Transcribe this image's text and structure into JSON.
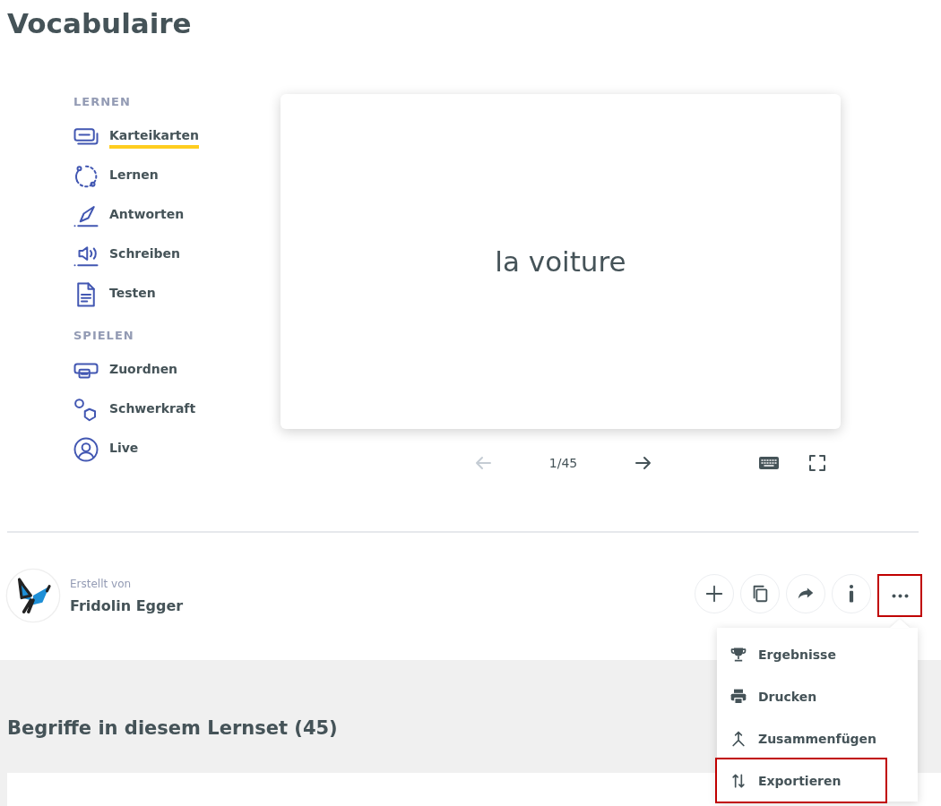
{
  "page": {
    "title": "Vocabulaire"
  },
  "sidebar": {
    "sections": [
      {
        "heading": "LERNEN",
        "items": [
          {
            "label": "Karteikarten",
            "kind": "cards",
            "selected": true
          },
          {
            "label": "Lernen",
            "kind": "cycle",
            "selected": false
          },
          {
            "label": "Antworten",
            "kind": "pen",
            "selected": false
          },
          {
            "label": "Schreiben",
            "kind": "speaker",
            "selected": false
          },
          {
            "label": "Testen",
            "kind": "document",
            "selected": false
          }
        ]
      },
      {
        "heading": "SPIELEN",
        "items": [
          {
            "label": "Zuordnen",
            "kind": "match",
            "selected": false
          },
          {
            "label": "Schwerkraft",
            "kind": "gravity",
            "selected": false
          },
          {
            "label": "Live",
            "kind": "person",
            "selected": false
          }
        ]
      }
    ]
  },
  "flashcard": {
    "term": "la voiture",
    "counter": "1/45",
    "controls": [
      {
        "kind": "previous",
        "disabled": true
      },
      {
        "kind": "next",
        "disabled": false
      },
      {
        "kind": "keyboard",
        "disabled": false
      },
      {
        "kind": "fullscreen",
        "disabled": false
      }
    ]
  },
  "author": {
    "label": "Erstellt von",
    "name": "Fridolin Egger"
  },
  "actions": [
    {
      "kind": "add",
      "highlighted": false
    },
    {
      "kind": "copy",
      "highlighted": false
    },
    {
      "kind": "share",
      "highlighted": false
    },
    {
      "kind": "info",
      "highlighted": false
    },
    {
      "kind": "more",
      "highlighted": true
    }
  ],
  "menu": {
    "items": [
      {
        "label": "Ergebnisse",
        "kind": "trophy",
        "highlighted": false
      },
      {
        "label": "Drucken",
        "kind": "printer",
        "highlighted": false
      },
      {
        "label": "Zusammenfügen",
        "kind": "merge",
        "highlighted": false
      },
      {
        "label": "Exportieren",
        "kind": "export",
        "highlighted": true
      }
    ]
  },
  "terms": {
    "heading": "Begriffe in diesem Lernset (45)"
  }
}
